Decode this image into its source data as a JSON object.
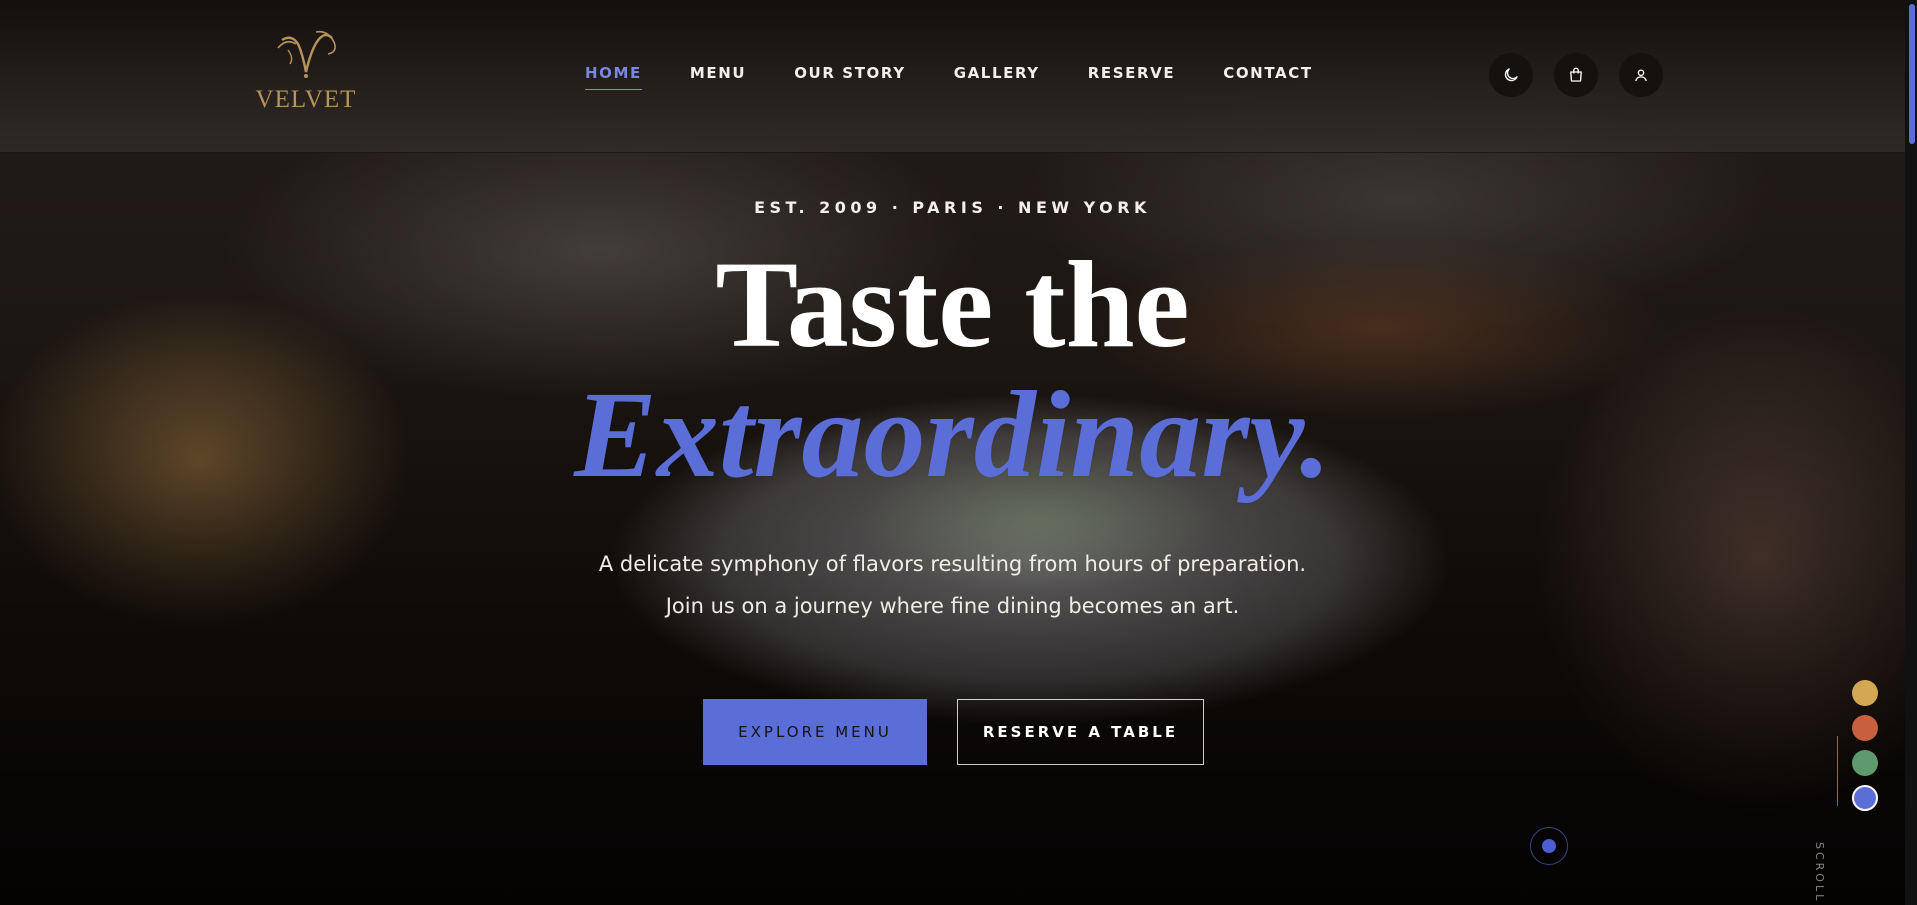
{
  "brand": {
    "name": "VELVET",
    "color": "#b8935a"
  },
  "nav": {
    "items": [
      {
        "label": "HOME",
        "active": true
      },
      {
        "label": "MENU"
      },
      {
        "label": "OUR STORY"
      },
      {
        "label": "GALLERY"
      },
      {
        "label": "RESERVE"
      },
      {
        "label": "CONTACT"
      }
    ]
  },
  "header_icons": [
    "moon-icon",
    "shopping-bag-icon",
    "user-icon"
  ],
  "hero": {
    "eyebrow": "EST. 2009 · PARIS · NEW YORK",
    "title_line1": "Taste the",
    "title_line2": "Extraordinary.",
    "subtitle_line1": "A delicate symphony of flavors resulting from hours of preparation.",
    "subtitle_line2": "Join us on a journey where fine dining becomes an art.",
    "primary_button": "EXPLORE MENU",
    "secondary_button": "RESERVE A TABLE"
  },
  "theme_swatches": [
    {
      "color": "#d4a853",
      "selected": false
    },
    {
      "color": "#c8603f",
      "selected": false
    },
    {
      "color": "#5e9a6e",
      "selected": false
    },
    {
      "color": "#5b6dd6",
      "selected": true
    }
  ],
  "scroll_label": "SCROLL",
  "colors": {
    "accent": "#5b6dd6",
    "text": "#ffffff"
  }
}
